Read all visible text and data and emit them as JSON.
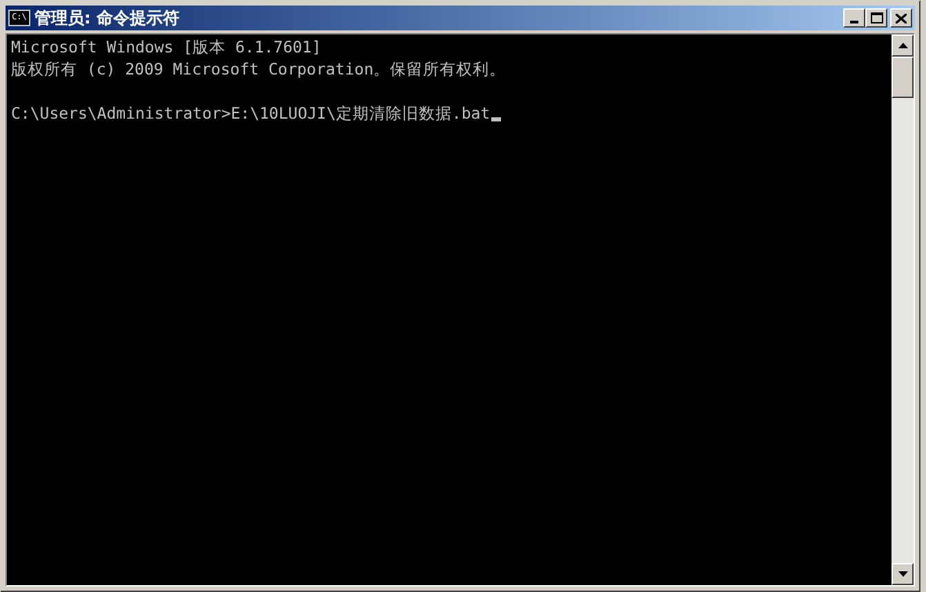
{
  "window": {
    "title": "管理员: 命令提示符",
    "icon_label": "C:\\"
  },
  "console": {
    "blocks": [
      [
        "Microsoft Windows [版本 6.1.7601]",
        "版权所有 (c) 2009 Microsoft Corporation。保留所有权利。"
      ],
      [
        "C:\\Users\\Administrator>E:\\10LUOJI\\定期清除旧数据.bat"
      ]
    ],
    "cursor_visible": true
  }
}
